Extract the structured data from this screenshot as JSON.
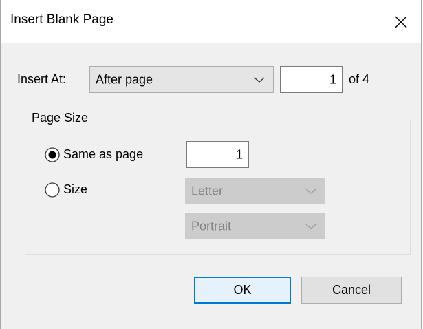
{
  "dialog": {
    "title": "Insert Blank Page"
  },
  "insert_at": {
    "label": "Insert At:",
    "position_selected": "After page",
    "page_number": "1",
    "of_total": "of 4"
  },
  "page_size": {
    "group_label": "Page Size",
    "same_as_page": {
      "label": "Same as page",
      "selected": true,
      "page_number": "1"
    },
    "size": {
      "label": "Size",
      "selected": false,
      "paper_selected": "Letter",
      "orientation_selected": "Portrait"
    }
  },
  "buttons": {
    "ok_label": "OK",
    "cancel_label": "Cancel"
  },
  "icons": {
    "close": "close-icon",
    "dropdown": "chevron-down-icon",
    "radio_selected": "radio-selected-icon",
    "radio_unselected": "radio-unselected-icon"
  },
  "colors": {
    "accent": "#0078d7",
    "dialog_background": "#f0f0f0",
    "titlebar_background": "#ffffff",
    "disabled_text": "#838383"
  }
}
